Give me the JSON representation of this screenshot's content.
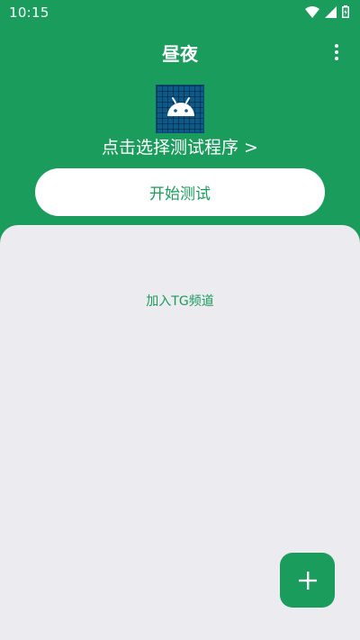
{
  "status_bar": {
    "time": "10:15"
  },
  "app_bar": {
    "title": "昼夜"
  },
  "main": {
    "select_program_label": "点击选择测试程序 >",
    "start_button_label": "开始测试"
  },
  "panel": {
    "join_tg_label": "加入TG频道"
  },
  "colors": {
    "primary": "#1a9c5c",
    "panel_background": "#ebebf0",
    "icon_background": "#0d5a8a"
  },
  "icons": {
    "menu": "more-vert-icon",
    "app": "android-icon",
    "fab": "plus-icon"
  }
}
